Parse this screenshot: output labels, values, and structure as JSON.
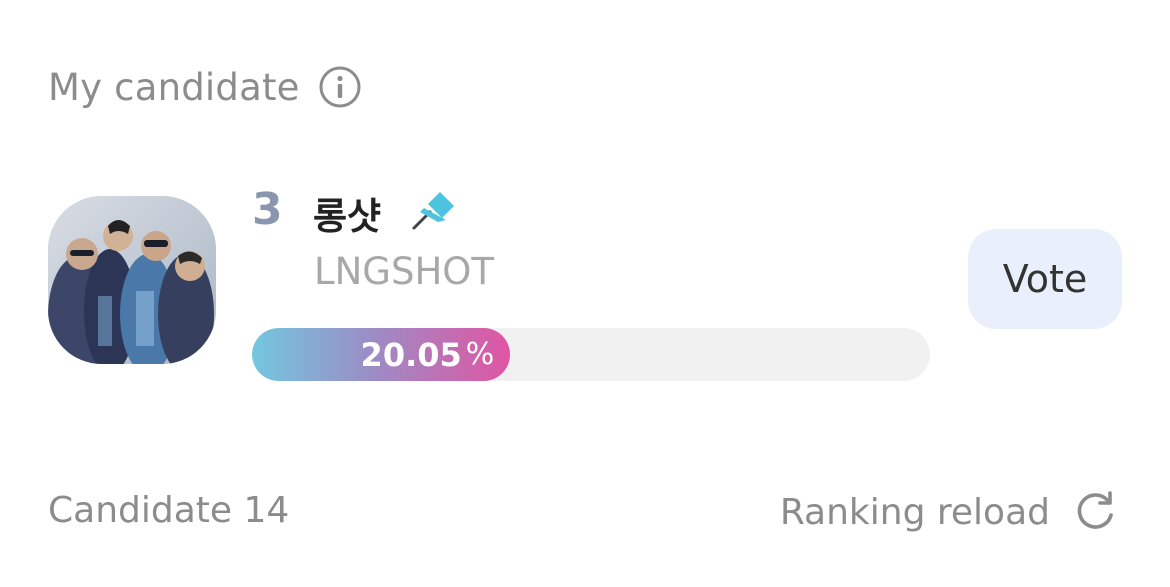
{
  "section": {
    "title": "My candidate",
    "info_icon": "info-icon"
  },
  "candidate": {
    "rank": "3",
    "name_korean": "롱샷",
    "name_english": "LNGSHOT",
    "pin_icon": "pin-icon",
    "avatar": "group-photo-avatar",
    "percentage": 20.05,
    "percentage_text": "20.05",
    "percentage_unit": "%"
  },
  "vote_button": {
    "label": "Vote"
  },
  "footer": {
    "candidate_count": "Candidate 14",
    "reload_label": "Ranking reload",
    "reload_icon": "refresh-icon"
  },
  "colors": {
    "rank": "#8a96ad",
    "progress_start": "#74c7e0",
    "progress_end": "#e055a3",
    "vote_button_bg": "#eaf0fb",
    "pin": "#4ec3e0"
  }
}
